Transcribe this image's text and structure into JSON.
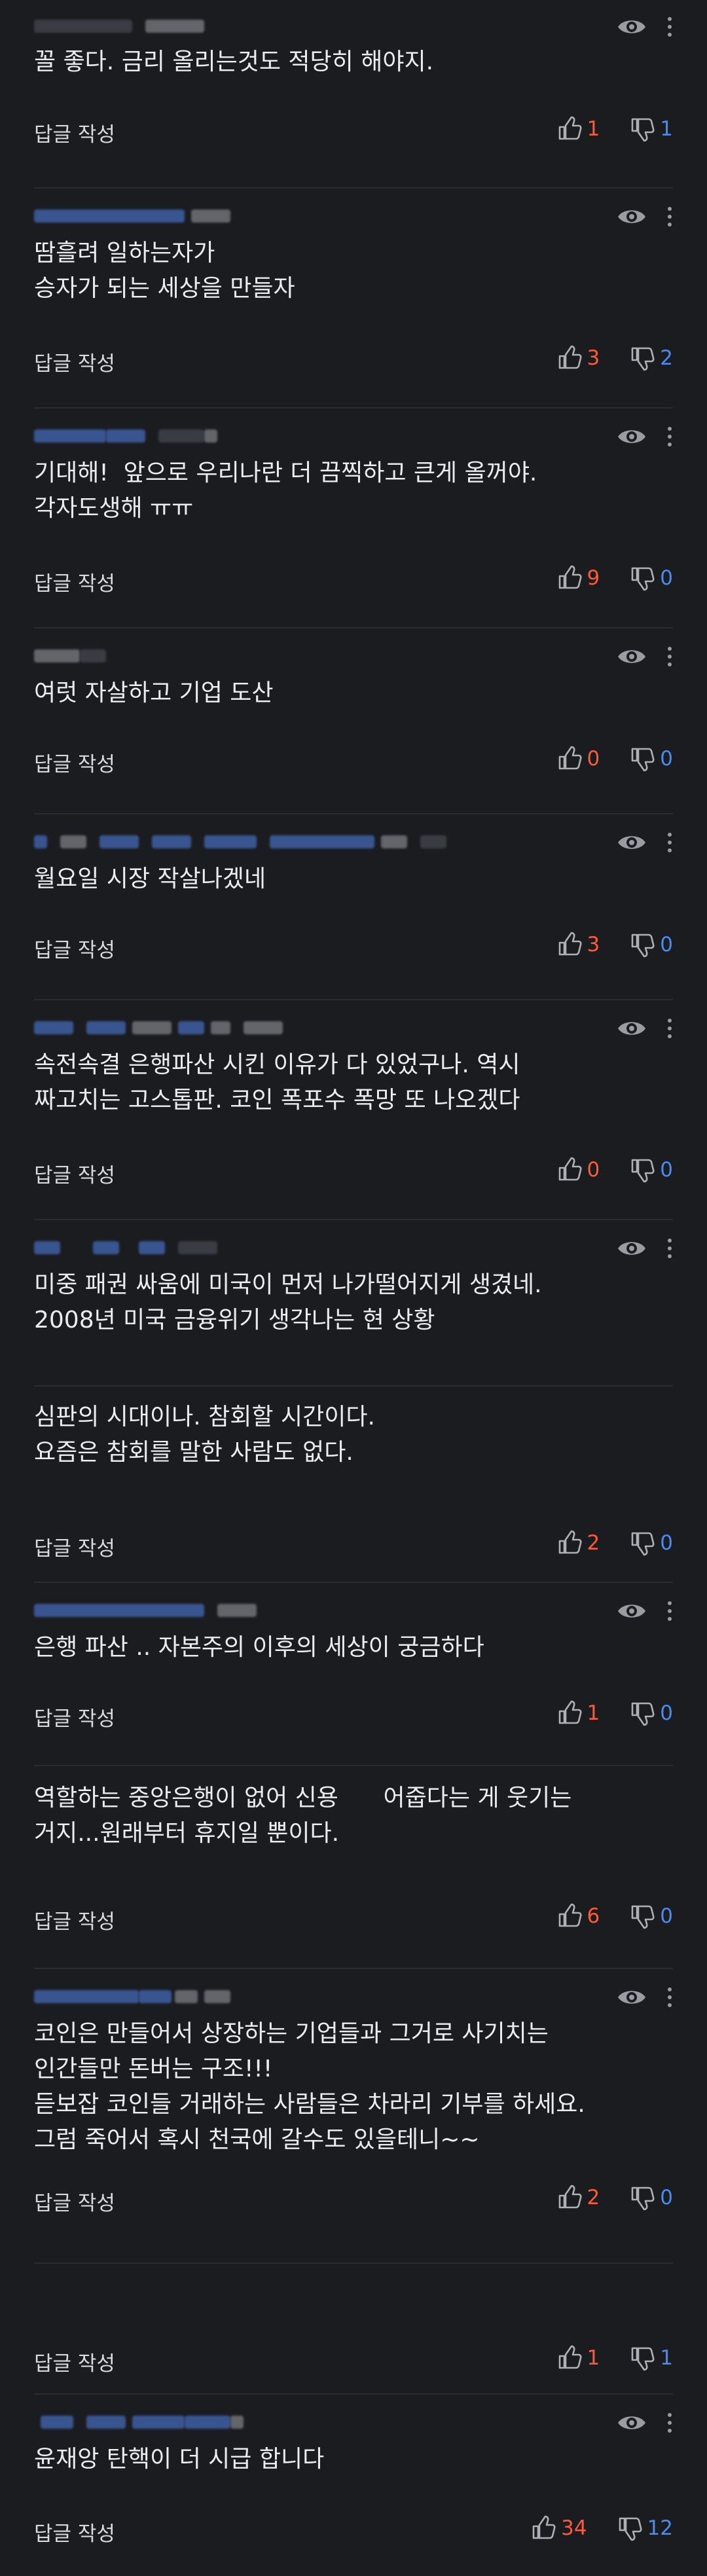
{
  "reply_label": "답글 작성",
  "colors": {
    "background": "#1b1c1f",
    "like": "#ff5a36",
    "dislike": "#4a8bf2"
  },
  "comments": [
    {
      "lines": "꼴 좋다. 금리 올리는것도 적당히 해야지.",
      "likes": "1",
      "dislikes": "1"
    },
    {
      "lines": "땀흘려 일하는자가\n승자가 되는 세상을 만들자",
      "likes": "3",
      "dislikes": "2"
    },
    {
      "lines": "기대해!  앞으로 우리나란 더 끔찍하고 큰게 올꺼야.\n각자도생해 ㅠㅠ",
      "likes": "9",
      "dislikes": "0"
    },
    {
      "lines": "여럿 자살하고 기업 도산",
      "likes": "0",
      "dislikes": "0"
    },
    {
      "lines": "월요일 시장 작살나겠네",
      "likes": "3",
      "dislikes": "0"
    },
    {
      "lines": "속전속결 은행파산 시킨 이유가 다 있었구나. 역시\n짜고치는 고스톱판. 코인 폭포수 폭망 또 나오겠다",
      "likes": "0",
      "dislikes": "0"
    },
    {
      "lines": "미중 패권 싸움에 미국이 먼저 나가떨어지게 생겼네.\n2008년 미국 금융위기 생각나는 현 상황",
      "likes": "",
      "dislikes": ""
    },
    {
      "lines": "심판의 시대이나. 참회할 시간이다.\n요즘은 참회를 말한 사람도 없다.",
      "likes": "2",
      "dislikes": "0"
    },
    {
      "lines": "은행 파산 .. 자본주의 이후의 세상이 궁금하다",
      "likes": "1",
      "dislikes": "0"
    },
    {
      "lines": "역할하는 중앙은행이 없어 신용      어줍다는 게 웃기는\n거지...원래부터 휴지일 뿐이다.",
      "likes": "6",
      "dislikes": "0"
    },
    {
      "lines": "코인은 만들어서 상장하는 기업들과 그거로 사기치는\n인간들만 돈버는 구조!!!\n듣보잡 코인들 거래하는 사람들은 차라리 기부를 하세요.\n그럼 죽어서 혹시 천국에 갈수도 있을테니~~",
      "likes": "2",
      "dislikes": "0"
    },
    {
      "lines": "",
      "likes": "1",
      "dislikes": "1"
    },
    {
      "lines": "윤재앙 탄핵이 더 시급 합니다",
      "likes": "34",
      "dislikes": "12"
    }
  ]
}
